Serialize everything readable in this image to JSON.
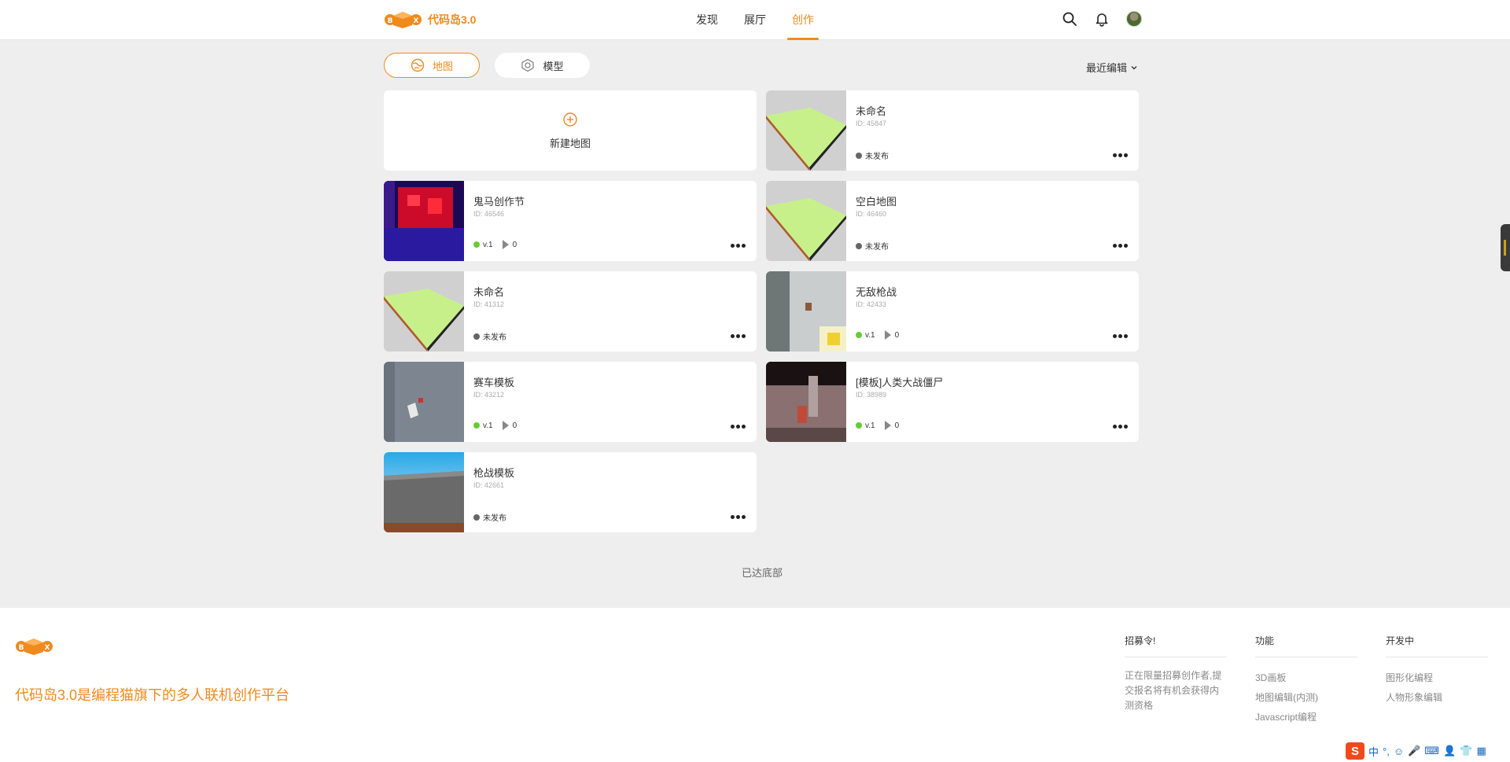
{
  "header": {
    "app_name": "代码岛3.0",
    "nav": [
      "发现",
      "展厅",
      "创作"
    ],
    "active_nav": "创作"
  },
  "tabs": {
    "map": "地图",
    "model": "模型"
  },
  "sort_label": "最近编辑",
  "new_map_label": "新建地图",
  "cards": [
    {
      "title": "未命名",
      "id": "ID: 45847",
      "status": "未发布",
      "published": false,
      "thumb": "flat-green"
    },
    {
      "title": "鬼马创作节",
      "id": "ID: 46546",
      "status": "v.1",
      "plays": "0",
      "published": true,
      "thumb": "red-blue"
    },
    {
      "title": "空白地图",
      "id": "ID: 46460",
      "status": "未发布",
      "published": false,
      "thumb": "flat-green"
    },
    {
      "title": "未命名",
      "id": "ID: 41312",
      "status": "未发布",
      "published": false,
      "thumb": "flat-green"
    },
    {
      "title": "无敌枪战",
      "id": "ID: 42433",
      "status": "v.1",
      "plays": "0",
      "published": true,
      "thumb": "wall-yellow"
    },
    {
      "title": "赛车模板",
      "id": "ID: 43212",
      "status": "v.1",
      "plays": "0",
      "published": true,
      "thumb": "gray-car"
    },
    {
      "title": "[模板]人类大战僵尸",
      "id": "ID: 38989",
      "status": "v.1",
      "plays": "0",
      "published": true,
      "thumb": "dark-room"
    },
    {
      "title": "枪战模板",
      "id": "ID: 42661",
      "status": "未发布",
      "published": false,
      "thumb": "sky-block"
    }
  ],
  "end_text": "已达底部",
  "footer": {
    "slogan": "代码岛3.0是编程猫旗下的多人联机创作平台",
    "col1": {
      "title": "招募令!",
      "text": "正在限量招募创作者,提交报名将有机会获得内测资格"
    },
    "col2": {
      "title": "功能",
      "items": [
        "3D画板",
        "地图编辑(内测)",
        "Javascript编程"
      ]
    },
    "col3": {
      "title": "开发中",
      "items": [
        "图形化编程",
        "人物形象编辑"
      ]
    }
  },
  "ime": {
    "brand": "S",
    "mode": "中"
  },
  "colors": {
    "accent": "#f08a1c",
    "published": "#66cc33",
    "unpublished": "#666666"
  }
}
